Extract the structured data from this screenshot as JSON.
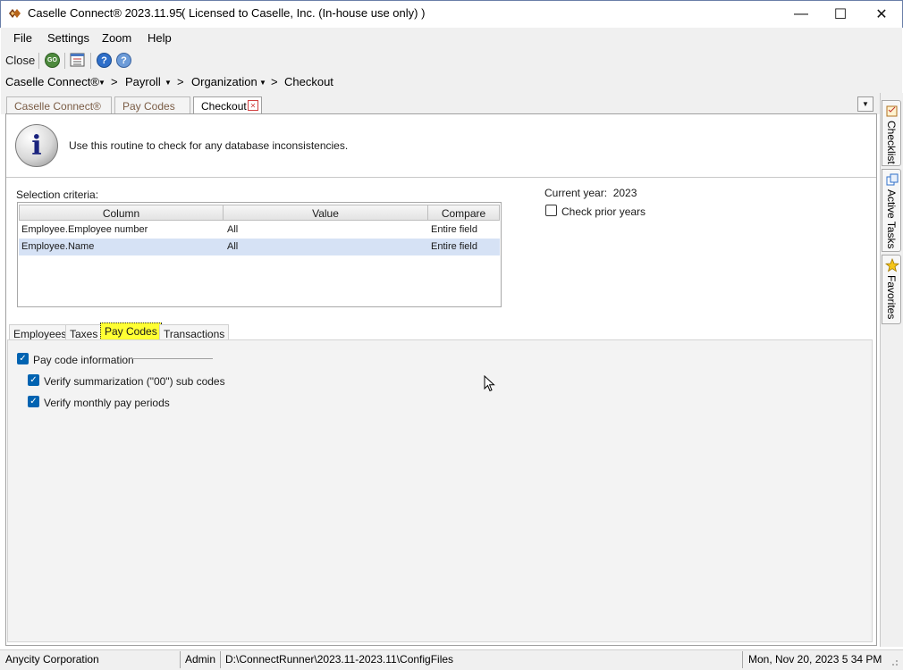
{
  "window": {
    "title": "Caselle Connect® 2023.11.95",
    "license": "( Licensed to Caselle, Inc. (In-house use only) )",
    "minimize_glyph": "—",
    "maximize_glyph": "☐",
    "close_glyph": "✕"
  },
  "menu": [
    "File",
    "Settings",
    "Zoom",
    "Help"
  ],
  "toolbar": {
    "close_label": "Close",
    "go_icon_text": "GO"
  },
  "breadcrumb": {
    "items": [
      "Caselle Connect®",
      "Payroll",
      "Organization",
      "Checkout"
    ],
    "separator": ">",
    "caret": "▼"
  },
  "tabs": [
    {
      "label": "Caselle Connect®",
      "active": false
    },
    {
      "label": "Pay Codes",
      "active": false
    },
    {
      "label": "Checkout",
      "active": true
    }
  ],
  "tab_close_glyph": "✕",
  "info": {
    "text": "Use this routine to check for any database inconsistencies.",
    "icon_letter": "i"
  },
  "selection": {
    "label": "Selection criteria:",
    "columns": [
      "Column",
      "Value",
      "Compare"
    ],
    "rows": [
      {
        "column": "Employee.Employee number",
        "value": "All",
        "compare": "Entire field",
        "selected": false
      },
      {
        "column": "Employee.Name",
        "value": "All",
        "compare": "Entire field",
        "selected": true
      }
    ]
  },
  "year": {
    "label": "Current year:",
    "value": "2023",
    "check_prior_label": "Check prior years",
    "check_prior": false
  },
  "inner_tabs": [
    {
      "label": "Employees",
      "active": false
    },
    {
      "label": "Taxes",
      "active": false
    },
    {
      "label": "Pay Codes",
      "active": true
    },
    {
      "label": "Transactions",
      "active": false
    }
  ],
  "options": {
    "group_label": "Pay code information",
    "group_checked": true,
    "items": [
      {
        "label": "Verify summarization (\"00\") sub codes",
        "checked": true
      },
      {
        "label": "Verify monthly pay periods",
        "checked": true
      }
    ]
  },
  "dock": [
    "Checklist",
    "Active Tasks",
    "Favorites"
  ],
  "status": {
    "company": "Anycity Corporation",
    "user": "Admin",
    "path": "D:\\ConnectRunner\\2023.11-2023.11\\ConfigFiles",
    "datetime": "Mon, Nov 20, 2023 5 34 PM"
  },
  "colors": {
    "accent": "#0063b1",
    "active_inner_tab": "#ffff33",
    "selected_row": "#d6e2f5",
    "info_icon": "#1a237e"
  }
}
